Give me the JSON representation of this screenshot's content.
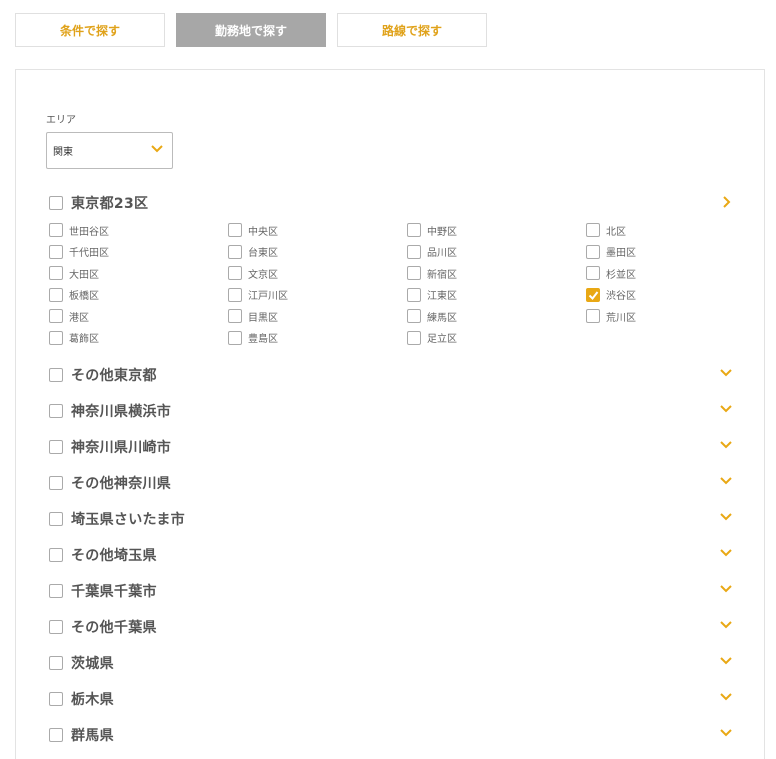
{
  "tabs": [
    {
      "label": "条件で探す",
      "active": false
    },
    {
      "label": "勤務地で探す",
      "active": true
    },
    {
      "label": "路線で探す",
      "active": false
    }
  ],
  "area": {
    "label": "エリア",
    "selected": "関東"
  },
  "accent_color": "#e9a814",
  "tokyo23": {
    "title": "東京都23区",
    "wards": [
      {
        "name": "世田谷区",
        "checked": false
      },
      {
        "name": "中央区",
        "checked": false
      },
      {
        "name": "中野区",
        "checked": false
      },
      {
        "name": "北区",
        "checked": false
      },
      {
        "name": "千代田区",
        "checked": false
      },
      {
        "name": "台東区",
        "checked": false
      },
      {
        "name": "品川区",
        "checked": false
      },
      {
        "name": "墨田区",
        "checked": false
      },
      {
        "name": "大田区",
        "checked": false
      },
      {
        "name": "文京区",
        "checked": false
      },
      {
        "name": "新宿区",
        "checked": false
      },
      {
        "name": "杉並区",
        "checked": false
      },
      {
        "name": "板橋区",
        "checked": false
      },
      {
        "name": "江戸川区",
        "checked": false
      },
      {
        "name": "江東区",
        "checked": false
      },
      {
        "name": "渋谷区",
        "checked": true
      },
      {
        "name": "港区",
        "checked": false
      },
      {
        "name": "目黒区",
        "checked": false
      },
      {
        "name": "練馬区",
        "checked": false
      },
      {
        "name": "荒川区",
        "checked": false
      },
      {
        "name": "葛飾区",
        "checked": false
      },
      {
        "name": "豊島区",
        "checked": false
      },
      {
        "name": "足立区",
        "checked": false
      }
    ]
  },
  "regions": [
    {
      "name": "その他東京都"
    },
    {
      "name": "神奈川県横浜市"
    },
    {
      "name": "神奈川県川崎市"
    },
    {
      "name": "その他神奈川県"
    },
    {
      "name": "埼玉県さいたま市"
    },
    {
      "name": "その他埼玉県"
    },
    {
      "name": "千葉県千葉市"
    },
    {
      "name": "その他千葉県"
    },
    {
      "name": "茨城県"
    },
    {
      "name": "栃木県"
    },
    {
      "name": "群馬県"
    }
  ]
}
